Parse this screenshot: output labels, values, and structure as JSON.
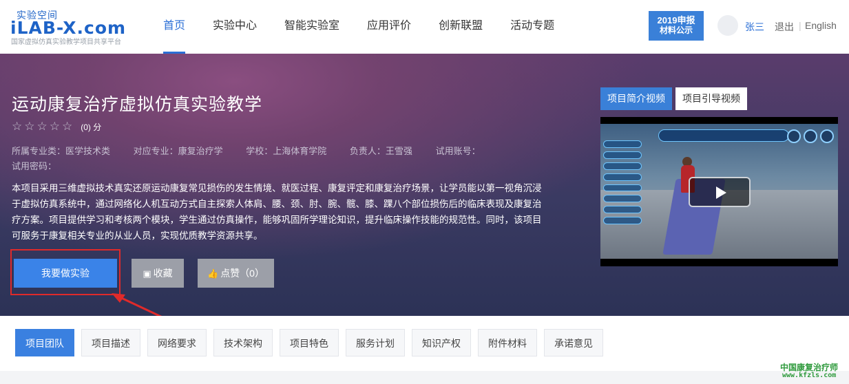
{
  "logo": {
    "cn": "实验空间",
    "main": "iLAB-X.com",
    "sub": "国家虚拟仿真实验教学项目共享平台"
  },
  "nav": [
    {
      "label": "首页",
      "active": true
    },
    {
      "label": "实验中心",
      "active": false
    },
    {
      "label": "智能实验室",
      "active": false
    },
    {
      "label": "应用评价",
      "active": false
    },
    {
      "label": "创新联盟",
      "active": false
    },
    {
      "label": "活动专题",
      "active": false
    }
  ],
  "badge": {
    "line1": "2019申报",
    "line2": "材料公示"
  },
  "user": {
    "name": "张三",
    "logout": "退出",
    "separator": "|",
    "language": "English"
  },
  "hero": {
    "title": "运动康复治疗虚拟仿真实验教学",
    "rating_stars": 0,
    "max_stars": 5,
    "score": "(0) 分",
    "meta": [
      "所属专业类：医学技术类",
      "对应专业：康复治疗学",
      "学校：上海体育学院",
      "负责人：王雪强",
      "试用账号："
    ],
    "meta2": "试用密码：",
    "description": "本项目采用三维虚拟技术真实还原运动康复常见损伤的发生情境、就医过程、康复评定和康复治疗场景，让学员能以第一视角沉浸于虚拟仿真系统中，通过网络化人机互动方式自主探索人体肩、腰、颈、肘、腕、髋、膝、踝八个部位损伤后的临床表现及康复治疗方案。项目提供学习和考核两个模块，学生通过仿真操作，能够巩固所学理论知识，提升临床操作技能的规范性。同时，该项目可服务于康复相关专业的从业人员，实现优质教学资源共享。",
    "buttons": {
      "start": "我要做实验",
      "favorite": "收藏",
      "like": "点赞（0）"
    }
  },
  "video": {
    "tabs": [
      {
        "label": "项目简介视频",
        "active": true
      },
      {
        "label": "项目引导视频",
        "active": false
      }
    ]
  },
  "tabs": [
    {
      "label": "项目团队",
      "active": true
    },
    {
      "label": "项目描述",
      "active": false
    },
    {
      "label": "网络要求",
      "active": false
    },
    {
      "label": "技术架构",
      "active": false
    },
    {
      "label": "项目特色",
      "active": false
    },
    {
      "label": "服务计划",
      "active": false
    },
    {
      "label": "知识产权",
      "active": false
    },
    {
      "label": "附件材料",
      "active": false
    },
    {
      "label": "承诺意见",
      "active": false
    }
  ],
  "watermark": {
    "line1": "中国康复治疗师",
    "line2": "www.kfzls.com"
  },
  "colors": {
    "accent": "#2b6fd6",
    "primary_button": "#3a83e8",
    "highlight": "#e02a2a",
    "watermark": "#2e9a3c"
  }
}
